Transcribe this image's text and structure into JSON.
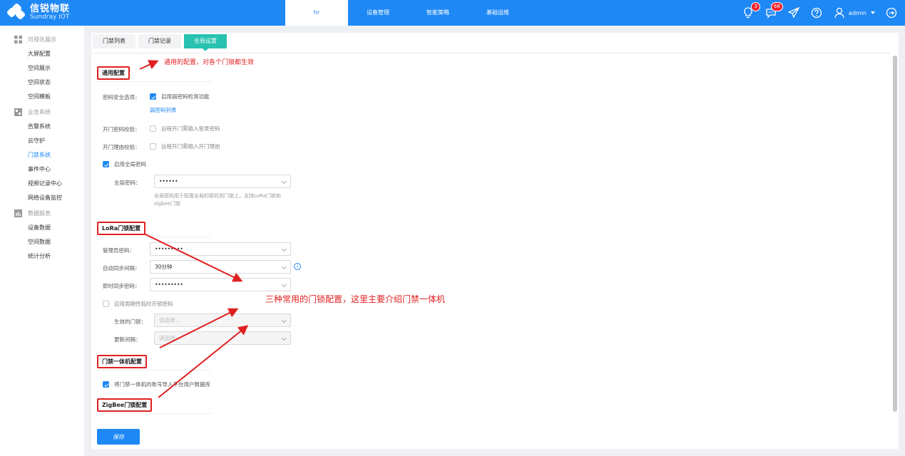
{
  "brand": {
    "name_cn": "信锐物联",
    "name_en": "Sundray IOT"
  },
  "nav": [
    {
      "label": "hr",
      "active": true
    },
    {
      "label": "设备管理"
    },
    {
      "label": "智能策略"
    },
    {
      "label": "基础运维"
    }
  ],
  "topright": {
    "bulb_badge": "3",
    "msg_badge": "68",
    "user": "admin"
  },
  "sidebar": {
    "groups": [
      {
        "title": "可视化展示",
        "items": [
          "大屏配置",
          "空间展示",
          "空间状态",
          "空间模板"
        ]
      },
      {
        "title": "业务系统",
        "items": [
          "告警系统",
          "云守护",
          "门禁系统",
          "事件中心",
          "视频记录中心",
          "网络设备监控"
        ]
      },
      {
        "title": "数据报表",
        "items": [
          "设备数据",
          "空间数据",
          "统计分析"
        ]
      }
    ]
  },
  "tabs": [
    "门禁列表",
    "门禁记录",
    "全局设置"
  ],
  "sections": {
    "general": {
      "title": "通用配置",
      "pwd_security_label": "密码安全选项：",
      "weak_pwd_check": "启用弱密码检测功能",
      "weak_pwd_list": "弱密码列表",
      "open_pwd_check_label": "开门密码校验：",
      "open_pwd_check": "远程开门需输入登录密码",
      "open_reason_check_label": "开门理由校验：",
      "open_reason_check": "远程开门需输入开门理由",
      "enable_global_pwd": "启用全局密码",
      "global_pwd_label": "全局密码：",
      "global_pwd_value": "••••••",
      "global_pwd_hint": "全局密码用于配置全局的密码到门锁上，支持LoRa门锁和zigbee门锁"
    },
    "lora": {
      "title": "LoRa门锁配置",
      "admin_pwd_label": "管理员密码：",
      "admin_pwd_value": "•••••••••",
      "auto_sync_label": "自动同步间隔：",
      "auto_sync_value": "30分钟",
      "instant_sync_label": "即时同步密码：",
      "instant_sync_value": "•••••••••",
      "enable_temp_pwd": "启用周期性临时开锁密码",
      "effective_lock_label": "生效的门锁：",
      "effective_lock_placeholder": "请选择...",
      "update_interval_label": "更新间隔：",
      "update_interval_placeholder": "请选择"
    },
    "access": {
      "title": "门禁一体机配置",
      "import_accounts": "将门禁一体机的账号导入平台用户数据库"
    },
    "zigbee": {
      "title": "ZigBee门锁配置"
    }
  },
  "annotations": {
    "top": "通用的配置，对各个门锁都生效",
    "middle": "三种常用的门锁配置，这里主要介绍门禁一体机"
  },
  "save_label": "保存",
  "colors": {
    "primary": "#1e88f5",
    "accent": "#27c2b0",
    "annotation": "#e02020"
  }
}
